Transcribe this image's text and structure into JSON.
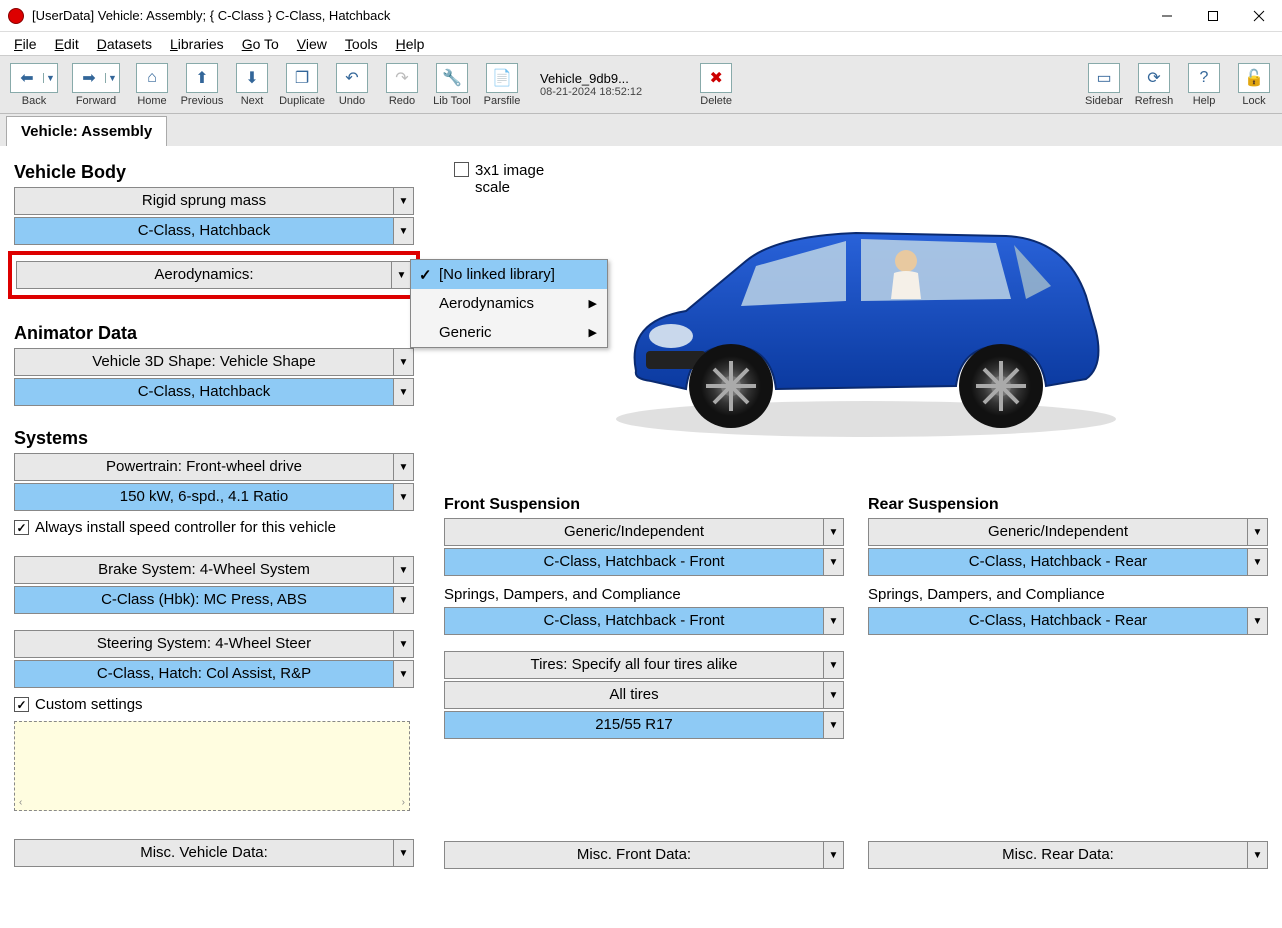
{
  "titlebar": "[UserData] Vehicle: Assembly; { C-Class } C-Class, Hatchback",
  "menu": {
    "file": "File",
    "edit": "Edit",
    "datasets": "Datasets",
    "libraries": "Libraries",
    "goto": "Go To",
    "view": "View",
    "tools": "Tools",
    "help": "Help"
  },
  "toolbar": {
    "back": "Back",
    "forward": "Forward",
    "home": "Home",
    "previous": "Previous",
    "next": "Next",
    "duplicate": "Duplicate",
    "undo": "Undo",
    "redo": "Redo",
    "libtool": "Lib Tool",
    "parsfile": "Parsfile",
    "delete": "Delete",
    "sidebar": "Sidebar",
    "refresh": "Refresh",
    "help": "Help",
    "lock": "Lock",
    "file_name": "Vehicle_9db9...",
    "file_ts": "08-21-2024 18:52:12"
  },
  "tab": "Vehicle: Assembly",
  "left": {
    "vehicle_body_h": "Vehicle Body",
    "rigid": "Rigid sprung mass",
    "cclass": "C-Class, Hatchback",
    "aero": "Aerodynamics:",
    "dropdown": {
      "no_linked": "[No linked library]",
      "aerodynamics": "Aerodynamics",
      "generic": "Generic"
    },
    "anim_h": "Animator Data",
    "shape": "Vehicle 3D Shape: Vehicle Shape",
    "anim_val": "C-Class, Hatchback",
    "systems_h": "Systems",
    "powertrain": "Powertrain: Front-wheel drive",
    "powertrain_val": "150 kW, 6-spd., 4.1 Ratio",
    "speed_chk": "Always install speed controller for this vehicle",
    "brake": "Brake System: 4-Wheel System",
    "brake_val": "C-Class (Hbk): MC Press, ABS",
    "steer": "Steering System: 4-Wheel Steer",
    "steer_val": "C-Class, Hatch: Col Assist, R&P",
    "custom_chk": "Custom settings",
    "misc_veh": "Misc. Vehicle Data:"
  },
  "right": {
    "scale_chk": "3x1 image scale",
    "front_h": "Front Suspension",
    "rear_h": "Rear Suspension",
    "generic_ind": "Generic/Independent",
    "front_val": "C-Class, Hatchback - Front",
    "rear_val": "C-Class, Hatchback - Rear",
    "sdc": "Springs, Dampers, and Compliance",
    "sdc_front": "C-Class, Hatchback - Front",
    "sdc_rear": "C-Class, Hatchback - Rear",
    "tires": "Tires: Specify all four tires alike",
    "all_tires": "All tires",
    "tire_val": "215/55 R17",
    "misc_front": "Misc. Front Data:",
    "misc_rear": "Misc. Rear Data:"
  }
}
